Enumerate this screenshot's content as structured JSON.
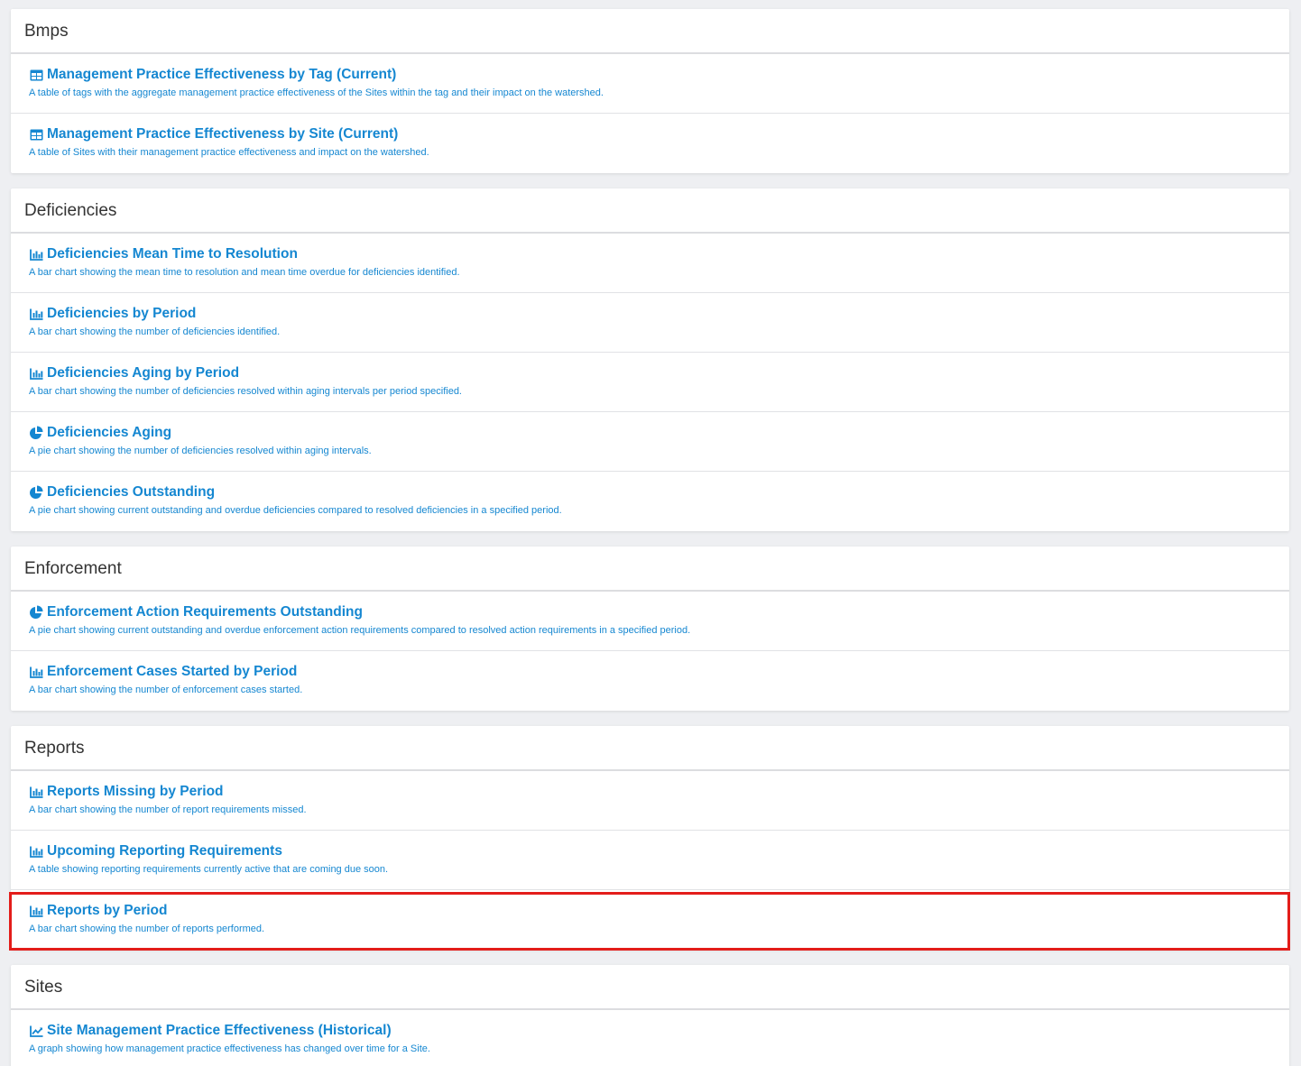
{
  "accent_color": "#1587d1",
  "highlight_color": "#e31d1a",
  "sections": [
    {
      "title": "Bmps",
      "items": [
        {
          "icon": "table-icon",
          "title": "Management Practice Effectiveness by Tag (Current)",
          "desc": "A table of tags with the aggregate management practice effectiveness of the Sites within the tag and their impact on the watershed."
        },
        {
          "icon": "table-icon",
          "title": "Management Practice Effectiveness by Site (Current)",
          "desc": "A table of Sites with their management practice effectiveness and impact on the watershed."
        }
      ]
    },
    {
      "title": "Deficiencies",
      "items": [
        {
          "icon": "bar-chart-icon",
          "title": "Deficiencies Mean Time to Resolution",
          "desc": "A bar chart showing the mean time to resolution and mean time overdue for deficiencies identified."
        },
        {
          "icon": "bar-chart-icon",
          "title": "Deficiencies by Period",
          "desc": "A bar chart showing the number of deficiencies identified."
        },
        {
          "icon": "bar-chart-icon",
          "title": "Deficiencies Aging by Period",
          "desc": "A bar chart showing the number of deficiencies resolved within aging intervals per period specified."
        },
        {
          "icon": "pie-chart-icon",
          "title": "Deficiencies Aging",
          "desc": "A pie chart showing the number of deficiencies resolved within aging intervals."
        },
        {
          "icon": "pie-chart-icon",
          "title": "Deficiencies Outstanding",
          "desc": "A pie chart showing current outstanding and overdue deficiencies compared to resolved deficiencies in a specified period."
        }
      ]
    },
    {
      "title": "Enforcement",
      "items": [
        {
          "icon": "pie-chart-icon",
          "title": "Enforcement Action Requirements Outstanding",
          "desc": "A pie chart showing current outstanding and overdue enforcement action requirements compared to resolved action requirements in a specified period."
        },
        {
          "icon": "bar-chart-icon",
          "title": "Enforcement Cases Started by Period",
          "desc": "A bar chart showing the number of enforcement cases started."
        }
      ]
    },
    {
      "title": "Reports",
      "items": [
        {
          "icon": "bar-chart-icon",
          "title": "Reports Missing by Period",
          "desc": "A bar chart showing the number of report requirements missed."
        },
        {
          "icon": "bar-chart-icon",
          "title": "Upcoming Reporting Requirements",
          "desc": "A table showing reporting requirements currently active that are coming due soon."
        },
        {
          "icon": "bar-chart-icon",
          "title": "Reports by Period",
          "desc": "A bar chart showing the number of reports performed.",
          "highlighted": true
        }
      ]
    },
    {
      "title": "Sites",
      "items": [
        {
          "icon": "line-chart-icon",
          "title": "Site Management Practice Effectiveness (Historical)",
          "desc": "A graph showing how management practice effectiveness has changed over time for a Site."
        }
      ]
    }
  ]
}
